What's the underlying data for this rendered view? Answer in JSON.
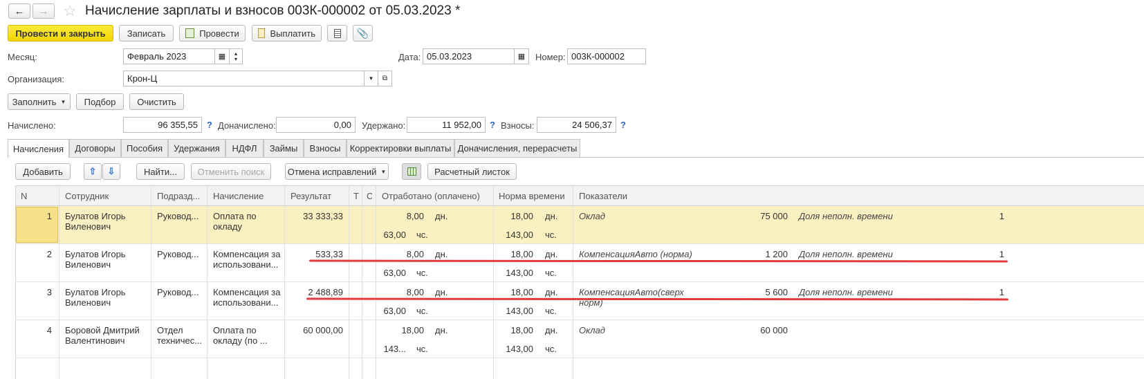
{
  "window": {
    "title": "Начисление зарплаты и взносов 003К-000002 от 05.03.2023 *"
  },
  "toolbar": {
    "post_close": "Провести и закрыть",
    "save": "Записать",
    "post": "Провести",
    "pay": "Выплатить"
  },
  "form": {
    "month_label": "Месяц:",
    "month_value": "Февраль 2023",
    "date_label": "Дата:",
    "date_value": "05.03.2023",
    "number_label": "Номер:",
    "number_value": "003К-000002",
    "org_label": "Организация:",
    "org_value": "Крон-Ц"
  },
  "actions": {
    "fill": "Заполнить",
    "select": "Подбор",
    "clear": "Очистить"
  },
  "totals": {
    "accrued_label": "Начислено:",
    "accrued_value": "96 355,55",
    "additional_label": "Доначислено:",
    "additional_value": "0,00",
    "withheld_label": "Удержано:",
    "withheld_value": "11 952,00",
    "contrib_label": "Взносы:",
    "contrib_value": "24 506,37",
    "help": "?"
  },
  "tabs": [
    "Начисления",
    "Договоры",
    "Пособия",
    "Удержания",
    "НДФЛ",
    "Займы",
    "Взносы",
    "Корректировки выплаты",
    "Доначисления, перерасчеты"
  ],
  "grid_toolbar": {
    "add": "Добавить",
    "find": "Найти...",
    "cancel_search": "Отменить поиск",
    "cancel_fix": "Отмена исправлений",
    "payslip": "Расчетный листок"
  },
  "columns": {
    "n": "N",
    "employee": "Сотрудник",
    "dept": "Подразд...",
    "accrual": "Начисление",
    "result": "Результат",
    "t": "Т",
    "c": "С",
    "worked": "Отработано (оплачено)",
    "norm": "Норма времени",
    "indicators": "Показатели"
  },
  "rows": [
    {
      "n": "1",
      "emp1": "Булатов Игорь",
      "emp2": "Виленович",
      "dept": "Руковод...",
      "acc1": "Оплата по",
      "acc2": "окладу",
      "result": "33 333,33",
      "w_days": "8,00",
      "w_d_unit": "дн.",
      "w_hours": "63,00",
      "w_h_unit": "чс.",
      "n_days": "18,00",
      "n_d_unit": "дн.",
      "n_hours": "143,00",
      "n_h_unit": "чс.",
      "ind1": "Оклад",
      "ind1b": "",
      "val1": "75 000",
      "ind2": "Доля неполн. времени",
      "val2": "1"
    },
    {
      "n": "2",
      "emp1": "Булатов Игорь",
      "emp2": "Виленович",
      "dept": "Руковод...",
      "acc1": "Компенсация за",
      "acc2": "использовани...",
      "result": "533,33",
      "w_days": "8,00",
      "w_d_unit": "дн.",
      "w_hours": "63,00",
      "w_h_unit": "чс.",
      "n_days": "18,00",
      "n_d_unit": "дн.",
      "n_hours": "143,00",
      "n_h_unit": "чс.",
      "ind1": "КомпенсацияАвто (норма)",
      "ind1b": "",
      "val1": "1 200",
      "ind2": "Доля неполн. времени",
      "val2": "1"
    },
    {
      "n": "3",
      "emp1": "Булатов Игорь",
      "emp2": "Виленович",
      "dept": "Руковод...",
      "acc1": "Компенсация за",
      "acc2": "использовани...",
      "result": "2 488,89",
      "w_days": "8,00",
      "w_d_unit": "дн.",
      "w_hours": "63,00",
      "w_h_unit": "чс.",
      "n_days": "18,00",
      "n_d_unit": "дн.",
      "n_hours": "143,00",
      "n_h_unit": "чс.",
      "ind1": "КомпенсацияАвто(сверх",
      "ind1b": "норм)",
      "val1": "5 600",
      "ind2": "Доля неполн. времени",
      "val2": "1"
    },
    {
      "n": "4",
      "emp1": "Боровой Дмитрий",
      "emp2": "Валентинович",
      "dept": "Отдел",
      "dept2": "техничес...",
      "acc1": "Оплата по",
      "acc2": "окладу (по ...",
      "result": "60 000,00",
      "w_days": "18,00",
      "w_d_unit": "дн.",
      "w_hours": "143...",
      "w_h_unit": "чс.",
      "n_days": "18,00",
      "n_d_unit": "дн.",
      "n_hours": "143,00",
      "n_h_unit": "чс.",
      "ind1": "Оклад",
      "ind1b": "",
      "val1": "60 000",
      "ind2": "",
      "val2": ""
    }
  ],
  "colors": {
    "accent_yellow": "#f5d800",
    "selected_row": "#fbf0c2",
    "help_blue": "#2a63b9",
    "underline_red": "#e33b3b"
  }
}
